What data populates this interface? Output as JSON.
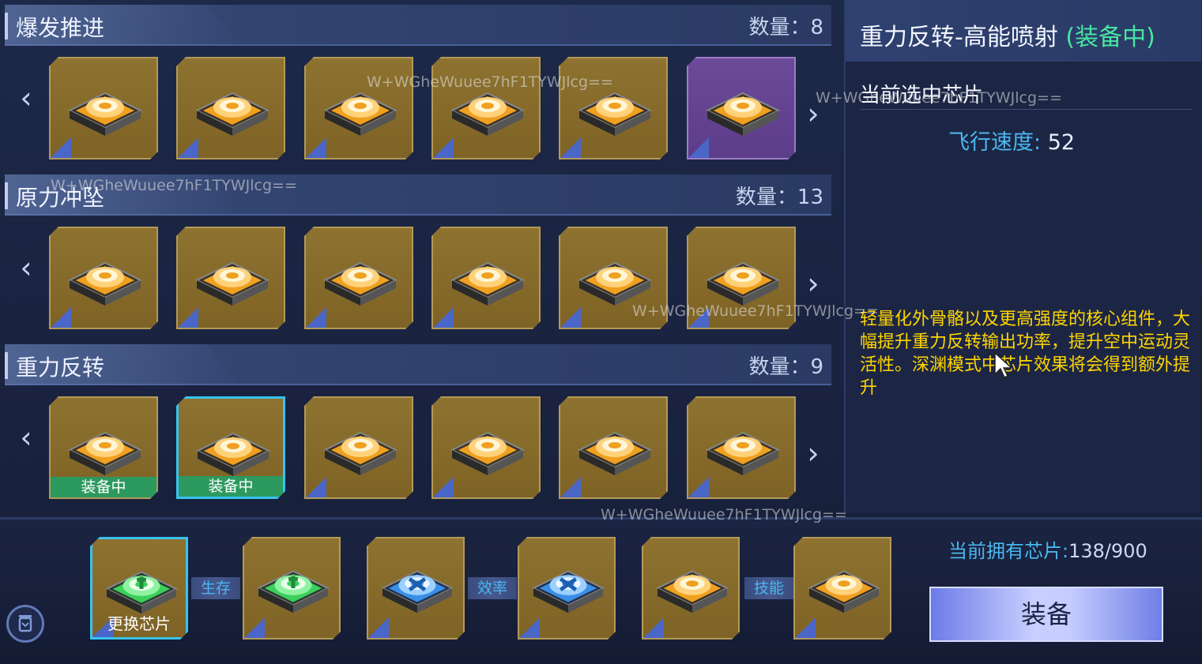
{
  "sections": [
    {
      "title": "爆发推进",
      "count_label": "数量：",
      "count": "8",
      "chips": [
        {
          "color": "gold"
        },
        {
          "color": "gold"
        },
        {
          "color": "gold"
        },
        {
          "color": "gold"
        },
        {
          "color": "gold"
        },
        {
          "color": "purple"
        }
      ]
    },
    {
      "title": "原力冲坠",
      "count_label": "数量：",
      "count": "13",
      "chips": [
        {
          "color": "gold"
        },
        {
          "color": "gold"
        },
        {
          "color": "gold"
        },
        {
          "color": "gold"
        },
        {
          "color": "gold"
        },
        {
          "color": "gold"
        }
      ]
    },
    {
      "title": "重力反转",
      "count_label": "数量：",
      "count": "9",
      "chips": [
        {
          "color": "gold",
          "badge": "装备中"
        },
        {
          "color": "gold",
          "badge": "装备中",
          "selected": true
        },
        {
          "color": "gold"
        },
        {
          "color": "gold"
        },
        {
          "color": "gold"
        },
        {
          "color": "gold"
        }
      ]
    }
  ],
  "arrows": {
    "left": "‹",
    "right": "›"
  },
  "detail": {
    "title": "重力反转-高能喷射",
    "status": "(装备中)",
    "subtitle": "当前选中芯片",
    "stat_label": "飞行速度:",
    "stat_value": "52",
    "description": "轻量化外骨骼以及更高强度的核心组件，大幅提升重力反转输出功率，提升空中运动灵活性。深渊模式中芯片效果将会得到额外提升"
  },
  "loadout": {
    "slots": [
      {
        "type": "green-cross",
        "caption": "更换芯片",
        "selected": true
      },
      {
        "type": "green-cross"
      },
      {
        "type": "blue-x"
      },
      {
        "type": "blue-x"
      },
      {
        "type": "gold"
      },
      {
        "type": "gold"
      }
    ],
    "connectors": [
      "生存",
      "效率",
      "技能"
    ]
  },
  "owned": {
    "label": "当前拥有芯片:",
    "value": "138/900"
  },
  "equip_button": "装备",
  "watermark": "W+WGheWuuee7hF1TYWJlcg==",
  "colors": {
    "accent": "#38c3f0",
    "equipped": "#2c9a5e",
    "status": "#46e6a0",
    "desc": "#ffd500",
    "label": "#4ab7f0"
  }
}
